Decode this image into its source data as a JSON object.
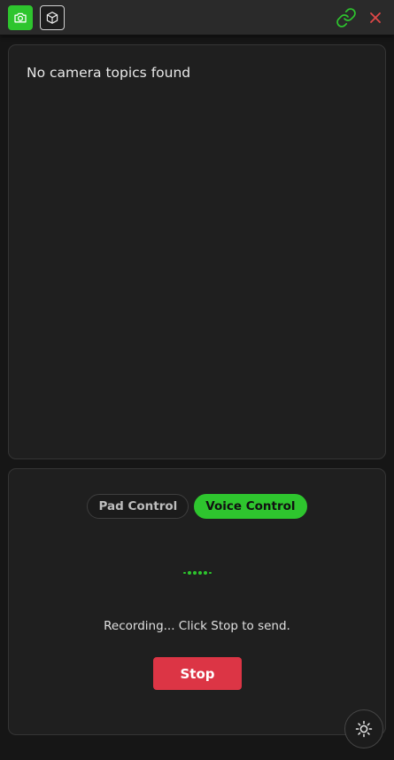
{
  "toolbar": {
    "camera_icon": "camera-icon",
    "model_icon": "cube-icon",
    "connection_icon": "link-icon",
    "close_icon": "close-icon"
  },
  "camera_panel": {
    "message": "No camera topics found"
  },
  "control_panel": {
    "modes": [
      {
        "label": "Pad Control",
        "active": false
      },
      {
        "label": "Voice Control",
        "active": true
      }
    ],
    "status_text": "Recording... Click Stop to send.",
    "stop_label": "Stop",
    "theme_icon": "sun-icon"
  },
  "colors": {
    "accent": "#2ec52e",
    "danger": "#dc3545",
    "close": "#e04848",
    "background": "#161616",
    "panel": "#1f1f1f"
  }
}
